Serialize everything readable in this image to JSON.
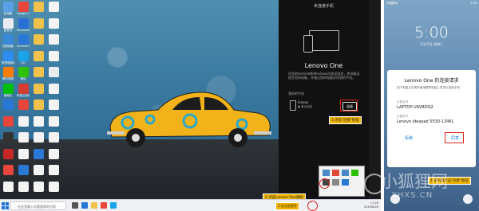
{
  "desktop": {
    "icons": [
      {
        "label": "此电脑",
        "color": "#5aa0e6"
      },
      {
        "label": "Google Chrome",
        "color": "#e8453c"
      },
      {
        "label": "",
        "color": "#f0c14b"
      },
      {
        "label": "",
        "color": "#f4f4f4"
      },
      {
        "label": "回收站",
        "color": "#e8ecf0"
      },
      {
        "label": "Microsoft Edge",
        "color": "#2a6fd6"
      },
      {
        "label": "",
        "color": "#f0c14b"
      },
      {
        "label": "",
        "color": "#f4f4f4"
      },
      {
        "label": "控制面板",
        "color": "#3b8ad9"
      },
      {
        "label": "Internet Explorer",
        "color": "#2a78d6"
      },
      {
        "label": "",
        "color": "#f0c14b"
      },
      {
        "label": "",
        "color": "#f4f4f4"
      },
      {
        "label": "联想电脑管家",
        "color": "#2d8cf0"
      },
      {
        "label": "QQ",
        "color": "#1aa3e8"
      },
      {
        "label": "",
        "color": "#f0c14b"
      },
      {
        "label": "",
        "color": "#f4f4f4"
      },
      {
        "label": "腾讯视频",
        "color": "#ff7d00"
      },
      {
        "label": "微信",
        "color": "#2dc100"
      },
      {
        "label": "",
        "color": "#f0c14b"
      },
      {
        "label": "",
        "color": "#e8ecf0"
      },
      {
        "label": "爱奇艺",
        "color": "#00be06"
      },
      {
        "label": "网易云音乐",
        "color": "#d43c33"
      },
      {
        "label": "",
        "color": "#f0c14b"
      },
      {
        "label": "",
        "color": "#f4f4f4"
      },
      {
        "label": "",
        "color": "#2a78d6"
      },
      {
        "label": "",
        "color": "#e8453c"
      },
      {
        "label": "",
        "color": "#f0c14b"
      },
      {
        "label": "",
        "color": "#f4f4f4"
      },
      {
        "label": "",
        "color": "#e8453c"
      },
      {
        "label": "",
        "color": "#f4f4f4"
      },
      {
        "label": "",
        "color": "#f4f4f4"
      },
      {
        "label": "",
        "color": "#f4f4f4"
      },
      {
        "label": "",
        "color": "#333333"
      },
      {
        "label": "",
        "color": "#f4f4f4"
      },
      {
        "label": "",
        "color": "#f4f4f4"
      },
      {
        "label": "",
        "color": "#f4f4f4"
      },
      {
        "label": "",
        "color": "#c62828"
      },
      {
        "label": "",
        "color": "#f4f4f4"
      },
      {
        "label": "",
        "color": "#2a78d6"
      },
      {
        "label": "",
        "color": "#f4f4f4"
      },
      {
        "label": "",
        "color": "#e8453c"
      },
      {
        "label": "",
        "color": "#2a78d6"
      },
      {
        "label": "",
        "color": "#f4f4f4"
      },
      {
        "label": "",
        "color": "#f4f4f4"
      },
      {
        "label": "",
        "color": "#f4f4f4"
      },
      {
        "label": "",
        "color": "#f4f4f4"
      },
      {
        "label": "",
        "color": "#f4f4f4"
      },
      {
        "label": "",
        "color": "#f4f4f4"
      }
    ]
  },
  "lenovo_one": {
    "top_label": "未连接手机",
    "app_name": "Lenovo One",
    "description": "在您的Android和Windows间发送消息，将设备连接至您的电脑，并通过您的电脑访问您的手机。",
    "my_devices_label": "我的的手机",
    "device_name": "lenovo",
    "device_status": "● 最近连接",
    "connect_button": "连接",
    "callout_connect": "3.点击\"连接\"按钮",
    "callout_open": "2.点击Lenovo One图标",
    "callout_step1": "1.先点击箭号"
  },
  "taskbar": {
    "search_placeholder": "在这里输入你要搜索的内容",
    "time": "11:26",
    "date": "2019/6/26"
  },
  "phone": {
    "status_left": "中国移动",
    "status_right": "5:00",
    "clock": "5:00",
    "date": "5月25日 星期三",
    "dialog_title": "Lenovo One 的连接请求",
    "dialog_text": "如下电脑正在请求使用联想电脑上的进行连接手机",
    "device_name_label": "设备名称",
    "device_name_value": "LAPTOP-U6VBOQ2",
    "device_model_label": "设备型号",
    "device_model_value": "Lenovo ideapad 5530-13IWL",
    "reject_button": "拒绝",
    "accept_button": "同意",
    "callout_accept": "4.手机端点击\"同意\"按钮"
  },
  "watermark": {
    "cn": "小狐狸网",
    "en": "XHXS.CN"
  }
}
